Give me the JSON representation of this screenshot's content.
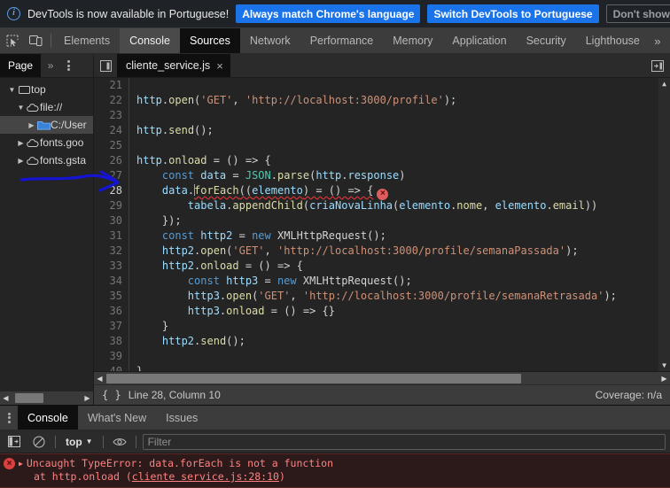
{
  "infobar": {
    "icon": "info-circle-icon",
    "message": "DevTools is now available in Portuguese!",
    "btn_always": "Always match Chrome's language",
    "btn_switch": "Switch DevTools to Portuguese",
    "btn_dismiss": "Don't show again"
  },
  "tabstrip": {
    "icons": [
      "inspect-element-icon",
      "device-toolbar-icon"
    ],
    "tabs": [
      {
        "label": "Elements",
        "state": "normal"
      },
      {
        "label": "Console",
        "state": "hover"
      },
      {
        "label": "Sources",
        "state": "active"
      },
      {
        "label": "Network",
        "state": "normal"
      },
      {
        "label": "Performance",
        "state": "normal"
      },
      {
        "label": "Memory",
        "state": "normal"
      },
      {
        "label": "Application",
        "state": "normal"
      },
      {
        "label": "Security",
        "state": "normal"
      },
      {
        "label": "Lighthouse",
        "state": "normal"
      }
    ],
    "more": "»"
  },
  "subbar": {
    "page_tab": "Page",
    "overflow": "»",
    "more_options": "kebab-menu-icon",
    "navigator_toggle": "show-navigator-icon",
    "file_tab": "cliente_service.js",
    "file_tab_close": "×",
    "right_panel_toggle": "show-debugger-icon"
  },
  "navigator": {
    "tree": [
      {
        "label": "top",
        "depth": 0,
        "twisty": "▼",
        "icon": "frame-icon",
        "selected": false
      },
      {
        "label": "file://",
        "depth": 1,
        "twisty": "▼",
        "icon": "cloud-icon",
        "selected": false
      },
      {
        "label": "C:/User",
        "depth": 2,
        "twisty": "▶",
        "icon": "folder-icon",
        "selected": true
      },
      {
        "label": "fonts.goo",
        "depth": 1,
        "twisty": "▶",
        "icon": "cloud-icon",
        "selected": false
      },
      {
        "label": "fonts.gsta",
        "depth": 1,
        "twisty": "▶",
        "icon": "cloud-icon",
        "selected": false
      }
    ],
    "scroll_left": "◀",
    "scroll_right": "▶"
  },
  "editor": {
    "first_line": 21,
    "lines": [
      {
        "n": 21,
        "tokens": []
      },
      {
        "n": 22,
        "tokens": [
          {
            "t": "http",
            "c": "tok-var"
          },
          {
            "t": ".",
            "c": "tok-punc"
          },
          {
            "t": "open",
            "c": "tok-prop"
          },
          {
            "t": "(",
            "c": "tok-punc"
          },
          {
            "t": "'GET'",
            "c": "tok-str"
          },
          {
            "t": ", ",
            "c": "tok-punc"
          },
          {
            "t": "'http://localhost:3000/profile'",
            "c": "tok-str"
          },
          {
            "t": ");",
            "c": "tok-punc"
          }
        ]
      },
      {
        "n": 23,
        "tokens": []
      },
      {
        "n": 24,
        "tokens": [
          {
            "t": "http",
            "c": "tok-var"
          },
          {
            "t": ".",
            "c": "tok-punc"
          },
          {
            "t": "send",
            "c": "tok-prop"
          },
          {
            "t": "();",
            "c": "tok-punc"
          }
        ]
      },
      {
        "n": 25,
        "tokens": []
      },
      {
        "n": 26,
        "tokens": [
          {
            "t": "http",
            "c": "tok-var"
          },
          {
            "t": ".",
            "c": "tok-punc"
          },
          {
            "t": "onload",
            "c": "tok-prop"
          },
          {
            "t": " = () => {",
            "c": "tok-punc"
          }
        ]
      },
      {
        "n": 27,
        "tokens": [
          {
            "t": "    ",
            "c": "tok-punc"
          },
          {
            "t": "const",
            "c": "tok-kw2"
          },
          {
            "t": " data ",
            "c": "tok-var"
          },
          {
            "t": "= ",
            "c": "tok-punc"
          },
          {
            "t": "JSON",
            "c": "tok-obj"
          },
          {
            "t": ".",
            "c": "tok-punc"
          },
          {
            "t": "parse",
            "c": "tok-prop"
          },
          {
            "t": "(",
            "c": "tok-punc"
          },
          {
            "t": "http",
            "c": "tok-var"
          },
          {
            "t": ".",
            "c": "tok-punc"
          },
          {
            "t": "response",
            "c": "tok-var"
          },
          {
            "t": ")",
            "c": "tok-punc"
          }
        ]
      },
      {
        "n": 28,
        "tokens": [
          {
            "t": "    ",
            "c": "tok-punc"
          },
          {
            "t": "data",
            "c": "tok-var"
          },
          {
            "t": ".",
            "c": "tok-punc"
          },
          {
            "t": "CARET",
            "c": "caret"
          },
          {
            "t": "forEach",
            "c": "tok-prop squiggle"
          },
          {
            "t": "((",
            "c": "tok-punc squiggle"
          },
          {
            "t": "elemento",
            "c": "tok-var squiggle"
          },
          {
            "t": ") = () => {",
            "c": "tok-punc squiggle"
          },
          {
            "t": "ERRDOT",
            "c": "err-dot"
          }
        ],
        "current": true
      },
      {
        "n": 29,
        "tokens": [
          {
            "t": "        ",
            "c": "tok-punc"
          },
          {
            "t": "tabela",
            "c": "tok-var"
          },
          {
            "t": ".",
            "c": "tok-punc"
          },
          {
            "t": "appendChild",
            "c": "tok-prop"
          },
          {
            "t": "(",
            "c": "tok-punc"
          },
          {
            "t": "criaNovaLinha",
            "c": "tok-var"
          },
          {
            "t": "(",
            "c": "tok-punc"
          },
          {
            "t": "elemento",
            "c": "tok-var"
          },
          {
            "t": ".",
            "c": "tok-punc"
          },
          {
            "t": "nome",
            "c": "tok-prop"
          },
          {
            "t": ", ",
            "c": "tok-punc"
          },
          {
            "t": "elemento",
            "c": "tok-var"
          },
          {
            "t": ".",
            "c": "tok-punc"
          },
          {
            "t": "email",
            "c": "tok-prop"
          },
          {
            "t": "))",
            "c": "tok-punc"
          }
        ]
      },
      {
        "n": 30,
        "tokens": [
          {
            "t": "    });",
            "c": "tok-punc"
          }
        ]
      },
      {
        "n": 31,
        "tokens": [
          {
            "t": "    ",
            "c": "tok-punc"
          },
          {
            "t": "const",
            "c": "tok-kw2"
          },
          {
            "t": " http2 ",
            "c": "tok-var"
          },
          {
            "t": "= ",
            "c": "tok-punc"
          },
          {
            "t": "new",
            "c": "tok-kw2"
          },
          {
            "t": " ",
            "c": "tok-punc"
          },
          {
            "t": "XMLHttpRequest",
            "c": "tok-def"
          },
          {
            "t": "();",
            "c": "tok-punc"
          }
        ]
      },
      {
        "n": 32,
        "tokens": [
          {
            "t": "    ",
            "c": "tok-punc"
          },
          {
            "t": "http2",
            "c": "tok-var"
          },
          {
            "t": ".",
            "c": "tok-punc"
          },
          {
            "t": "open",
            "c": "tok-prop"
          },
          {
            "t": "(",
            "c": "tok-punc"
          },
          {
            "t": "'GET'",
            "c": "tok-str"
          },
          {
            "t": ", ",
            "c": "tok-punc"
          },
          {
            "t": "'http://localhost:3000/profile/semanaPassada'",
            "c": "tok-str"
          },
          {
            "t": ");",
            "c": "tok-punc"
          }
        ]
      },
      {
        "n": 33,
        "tokens": [
          {
            "t": "    ",
            "c": "tok-punc"
          },
          {
            "t": "http2",
            "c": "tok-var"
          },
          {
            "t": ".",
            "c": "tok-punc"
          },
          {
            "t": "onload",
            "c": "tok-prop"
          },
          {
            "t": " = () => {",
            "c": "tok-punc"
          }
        ]
      },
      {
        "n": 34,
        "tokens": [
          {
            "t": "        ",
            "c": "tok-punc"
          },
          {
            "t": "const",
            "c": "tok-kw2"
          },
          {
            "t": " http3 ",
            "c": "tok-var"
          },
          {
            "t": "= ",
            "c": "tok-punc"
          },
          {
            "t": "new",
            "c": "tok-kw2"
          },
          {
            "t": " ",
            "c": "tok-punc"
          },
          {
            "t": "XMLHttpRequest",
            "c": "tok-def"
          },
          {
            "t": "();",
            "c": "tok-punc"
          }
        ]
      },
      {
        "n": 35,
        "tokens": [
          {
            "t": "        ",
            "c": "tok-punc"
          },
          {
            "t": "http3",
            "c": "tok-var"
          },
          {
            "t": ".",
            "c": "tok-punc"
          },
          {
            "t": "open",
            "c": "tok-prop"
          },
          {
            "t": "(",
            "c": "tok-punc"
          },
          {
            "t": "'GET'",
            "c": "tok-str"
          },
          {
            "t": ", ",
            "c": "tok-punc"
          },
          {
            "t": "'http://localhost:3000/profile/semanaRetrasada'",
            "c": "tok-str"
          },
          {
            "t": ");",
            "c": "tok-punc"
          }
        ]
      },
      {
        "n": 36,
        "tokens": [
          {
            "t": "        ",
            "c": "tok-punc"
          },
          {
            "t": "http3",
            "c": "tok-var"
          },
          {
            "t": ".",
            "c": "tok-punc"
          },
          {
            "t": "onload",
            "c": "tok-prop"
          },
          {
            "t": " = () => {}",
            "c": "tok-punc"
          }
        ]
      },
      {
        "n": 37,
        "tokens": [
          {
            "t": "    }",
            "c": "tok-punc"
          }
        ]
      },
      {
        "n": 38,
        "tokens": [
          {
            "t": "    ",
            "c": "tok-punc"
          },
          {
            "t": "http2",
            "c": "tok-var"
          },
          {
            "t": ".",
            "c": "tok-punc"
          },
          {
            "t": "send",
            "c": "tok-prop"
          },
          {
            "t": "();",
            "c": "tok-punc"
          }
        ]
      },
      {
        "n": 39,
        "tokens": []
      },
      {
        "n": 40,
        "tokens": [
          {
            "t": "}",
            "c": "tok-punc"
          }
        ]
      }
    ]
  },
  "statusbar": {
    "pretty_print": "{ }",
    "position": "Line 28, Column 10",
    "coverage": "Coverage: n/a"
  },
  "drawer": {
    "kebab": "kebab-menu-icon",
    "tabs": [
      {
        "label": "Console",
        "active": true
      },
      {
        "label": "What's New",
        "active": false
      },
      {
        "label": "Issues",
        "active": false
      }
    ],
    "toolbar": {
      "sidebar_icon": "console-sidebar-icon",
      "clear_icon": "clear-console-icon",
      "context": "top",
      "context_caret": "▼",
      "eye_icon": "live-expression-icon",
      "filter_placeholder": "Filter",
      "filter_value": ""
    },
    "messages": [
      {
        "level": "error",
        "badge": "×",
        "expander": "▶",
        "text": "Uncaught TypeError: data.forEach is not a function",
        "stack_prefix": "at http.onload (",
        "stack_link": "cliente service.js:28:10",
        "stack_suffix": ")"
      }
    ]
  },
  "colors": {
    "accent_blue": "#1a73e8",
    "error_red": "#ff8080",
    "annotation_blue": "#1414d2",
    "panel_bg": "#242424",
    "toolbar_bg": "#3c3c3c",
    "active_tab_bg": "#0f0f0f"
  }
}
